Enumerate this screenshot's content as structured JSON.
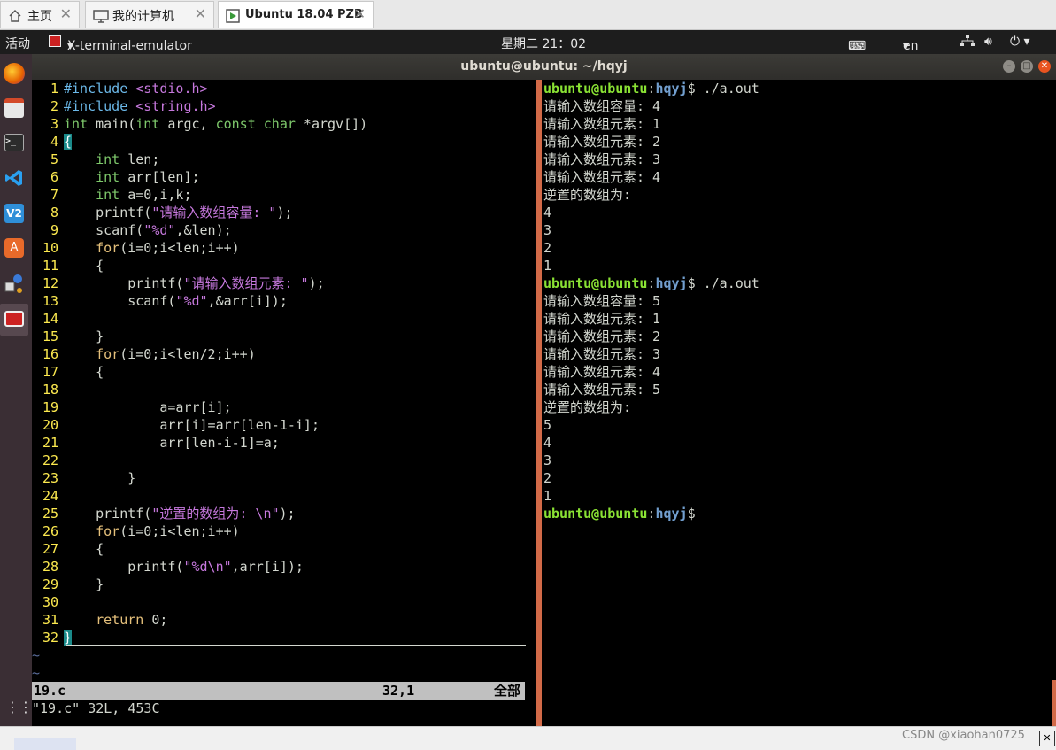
{
  "vm_tabs": [
    {
      "label": "主页",
      "icon": "home-icon"
    },
    {
      "label": "我的计算机",
      "icon": "computer-icon"
    },
    {
      "label": "Ubuntu 18.04 PZB",
      "icon": "vm-icon"
    }
  ],
  "topbar": {
    "activities": "活动",
    "app_name": "X-terminal-emulator",
    "clock": "星期二 21：02",
    "keyboard": "us",
    "lang": "en"
  },
  "window_title": "ubuntu@ubuntu: ~/hqyj",
  "dock_icons": [
    "firefox-icon",
    "files-icon",
    "terminal-icon",
    "vscode-icon",
    "vnc-icon",
    "software-icon",
    "network-tool-icon",
    "x-terminal-icon",
    "apps-grid-icon"
  ],
  "code_lines": [
    "#include <stdio.h>",
    "#include <string.h>",
    "int main(int argc, const char *argv[])",
    "{",
    "    int len;",
    "    int arr[len];",
    "    int a=0,i,k;",
    "    printf(\"请输入数组容量: \");",
    "    scanf(\"%d\",&len);",
    "    for(i=0;i<len;i++)",
    "    {",
    "        printf(\"请输入数组元素: \");",
    "        scanf(\"%d\",&arr[i]);",
    "",
    "    }",
    "    for(i=0;i<len/2;i++)",
    "    {",
    "",
    "            a=arr[i];",
    "            arr[i]=arr[len-1-i];",
    "            arr[len-i-1]=a;",
    "",
    "        }",
    "",
    "    printf(\"逆置的数组为: \\n\");",
    "    for(i=0;i<len;i++)",
    "    {",
    "        printf(\"%d\\n\",arr[i]);",
    "    }",
    "",
    "    return 0;",
    "}"
  ],
  "vim": {
    "tildes": [
      "~",
      "~"
    ],
    "status_file": "19.c",
    "status_pos": "32,1",
    "status_all": "全部",
    "cmdline": "\"19.c\" 32L, 453C"
  },
  "prompt": {
    "user": "ubuntu@ubuntu",
    "path": "hqyj",
    "symbol": "$"
  },
  "terminal_lines": [
    {
      "type": "prompt",
      "cmd": " ./a.out"
    },
    {
      "type": "text",
      "text": "请输入数组容量: 4"
    },
    {
      "type": "text",
      "text": "请输入数组元素: 1"
    },
    {
      "type": "text",
      "text": "请输入数组元素: 2"
    },
    {
      "type": "text",
      "text": "请输入数组元素: 3"
    },
    {
      "type": "text",
      "text": "请输入数组元素: 4"
    },
    {
      "type": "text",
      "text": "逆置的数组为:"
    },
    {
      "type": "text",
      "text": "4"
    },
    {
      "type": "text",
      "text": "3"
    },
    {
      "type": "text",
      "text": "2"
    },
    {
      "type": "text",
      "text": "1"
    },
    {
      "type": "prompt",
      "cmd": " ./a.out"
    },
    {
      "type": "text",
      "text": "请输入数组容量: 5"
    },
    {
      "type": "text",
      "text": "请输入数组元素: 1"
    },
    {
      "type": "text",
      "text": "请输入数组元素: 2"
    },
    {
      "type": "text",
      "text": "请输入数组元素: 3"
    },
    {
      "type": "text",
      "text": "请输入数组元素: 4"
    },
    {
      "type": "text",
      "text": "请输入数组元素: 5"
    },
    {
      "type": "text",
      "text": "逆置的数组为:"
    },
    {
      "type": "text",
      "text": "5"
    },
    {
      "type": "text",
      "text": "4"
    },
    {
      "type": "text",
      "text": "3"
    },
    {
      "type": "text",
      "text": "2"
    },
    {
      "type": "text",
      "text": "1"
    },
    {
      "type": "prompt",
      "cmd": ""
    }
  ],
  "watermark": "CSDN @xiaohan0725"
}
